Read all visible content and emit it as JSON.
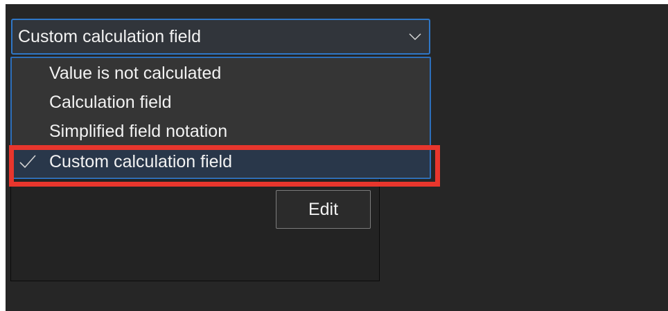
{
  "combo": {
    "selected_value": "Custom calculation field",
    "icon": "chevron-down-icon"
  },
  "dropdown": {
    "options": [
      {
        "label": "Value is not calculated",
        "selected": false
      },
      {
        "label": "Calculation field",
        "selected": false
      },
      {
        "label": "Simplified field notation",
        "selected": false
      },
      {
        "label": "Custom calculation field",
        "selected": true
      }
    ],
    "selected_icon": "check-icon"
  },
  "panel": {
    "edit_label": "Edit"
  },
  "colors": {
    "background": "#262626",
    "focus_border": "#2f77c8",
    "selection": "#29374a",
    "highlight": "#e8362d"
  }
}
